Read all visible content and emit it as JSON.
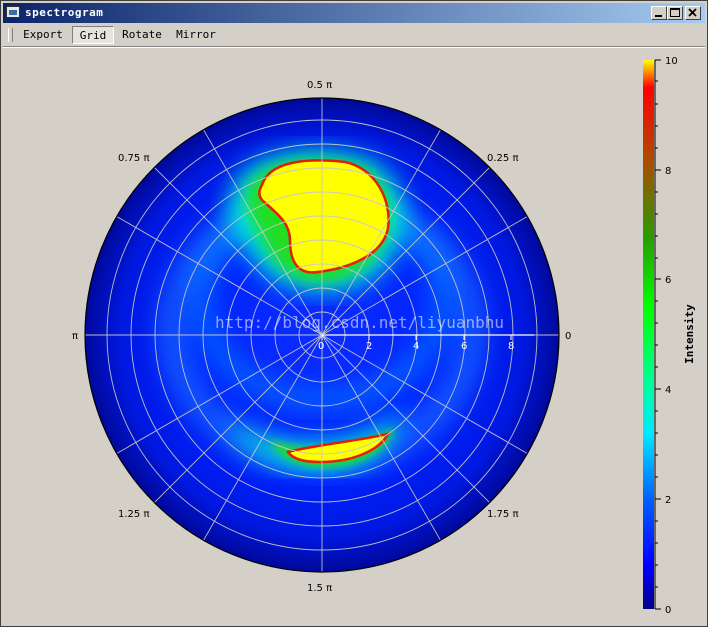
{
  "window": {
    "title": "spectrogram"
  },
  "toolbar": {
    "buttons": [
      {
        "label": "Export",
        "checked": false
      },
      {
        "label": "Grid",
        "checked": true
      },
      {
        "label": "Rotate",
        "checked": false
      },
      {
        "label": "Mirror",
        "checked": false
      }
    ]
  },
  "polar": {
    "angle_labels": {
      "a0": "0",
      "a025": "0.25 π",
      "a05": "0.5 π",
      "a075": "0.75 π",
      "a1": "π",
      "a125": "1.25 π",
      "a15": "1.5 π",
      "a175": "1.75 π"
    },
    "radial_labels": {
      "r0": "0",
      "r2": "2",
      "r4": "4",
      "r6": "6",
      "r8": "8"
    }
  },
  "colorbar": {
    "title": "Intensity",
    "ticks": {
      "t0": "0",
      "t2": "2",
      "t4": "4",
      "t6": "6",
      "t8": "8",
      "t10": "10"
    }
  },
  "watermark": "http://blog.csdn.net/liyuanbhu",
  "colors": {
    "min": "#00008b",
    "low": "#0000ff",
    "mid": "#00ffff",
    "high": "#00ff00",
    "upper": "#ffff00",
    "max": "#ff0000",
    "title_left": "#0a246a",
    "title_right": "#a6caf0"
  }
}
